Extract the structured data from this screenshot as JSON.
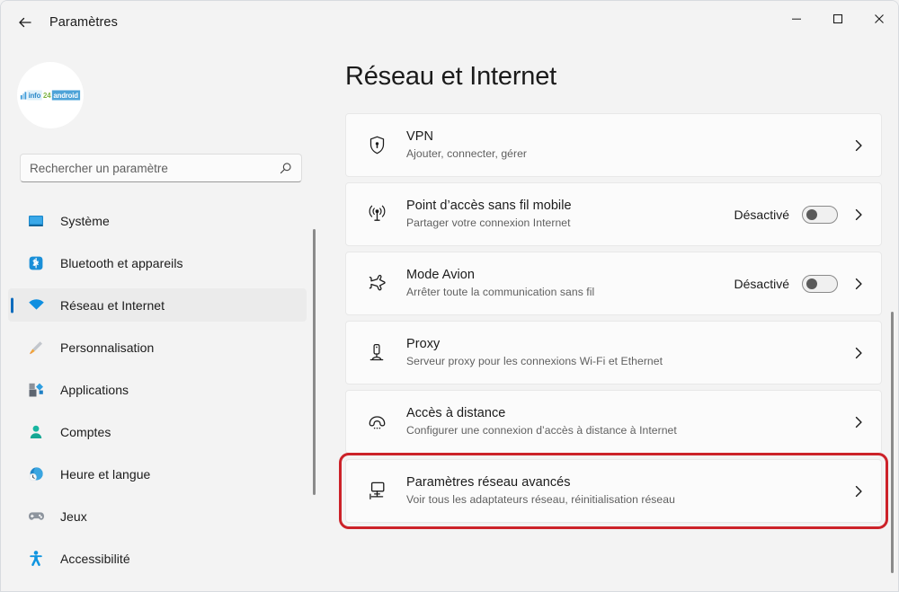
{
  "window": {
    "title": "Paramètres",
    "back_icon": "back-arrow-icon",
    "minimize_label": "—",
    "maximize_label": "□",
    "close_label": "✕"
  },
  "sidebar": {
    "avatar": {
      "logo_info": "info",
      "logo_24": "24",
      "logo_android": "android"
    },
    "search": {
      "placeholder": "Rechercher un paramètre",
      "value": "",
      "icon": "search-icon"
    },
    "items": [
      {
        "label": "Système",
        "icon": "monitor-icon",
        "selected": false
      },
      {
        "label": "Bluetooth et appareils",
        "icon": "bluetooth-icon",
        "selected": false
      },
      {
        "label": "Réseau et Internet",
        "icon": "wifi-icon",
        "selected": true
      },
      {
        "label": "Personnalisation",
        "icon": "paintbrush-icon",
        "selected": false
      },
      {
        "label": "Applications",
        "icon": "apps-icon",
        "selected": false
      },
      {
        "label": "Comptes",
        "icon": "person-icon",
        "selected": false
      },
      {
        "label": "Heure et langue",
        "icon": "clock-globe-icon",
        "selected": false
      },
      {
        "label": "Jeux",
        "icon": "gamepad-icon",
        "selected": false
      },
      {
        "label": "Accessibilité",
        "icon": "accessibility-icon",
        "selected": false
      }
    ]
  },
  "main": {
    "page_title": "Réseau et Internet",
    "cards": [
      {
        "title": "VPN",
        "subtitle": "Ajouter, connecter, gérer",
        "icon": "shield-lock-icon",
        "has_toggle": false,
        "toggle_state": "",
        "toggle_on": false,
        "highlighted": false
      },
      {
        "title": "Point d’accès sans fil mobile",
        "subtitle": "Partager votre connexion Internet",
        "icon": "hotspot-icon",
        "has_toggle": true,
        "toggle_state": "Désactivé",
        "toggle_on": false,
        "highlighted": false
      },
      {
        "title": "Mode Avion",
        "subtitle": "Arrêter toute la communication sans fil",
        "icon": "airplane-icon",
        "has_toggle": true,
        "toggle_state": "Désactivé",
        "toggle_on": false,
        "highlighted": false
      },
      {
        "title": "Proxy",
        "subtitle": "Serveur proxy pour les connexions Wi-Fi et Ethernet",
        "icon": "proxy-icon",
        "has_toggle": false,
        "toggle_state": "",
        "toggle_on": false,
        "highlighted": false
      },
      {
        "title": "Accès à distance",
        "subtitle": "Configurer une connexion d’accès à distance à Internet",
        "icon": "dialup-icon",
        "has_toggle": false,
        "toggle_state": "",
        "toggle_on": false,
        "highlighted": false
      },
      {
        "title": "Paramètres réseau avancés",
        "subtitle": "Voir tous les adaptateurs réseau, réinitialisation réseau",
        "icon": "network-adapter-icon",
        "has_toggle": false,
        "toggle_state": "",
        "toggle_on": false,
        "highlighted": true
      }
    ]
  },
  "colors": {
    "accent": "#0f6cbd",
    "highlight_border": "#cc2229",
    "window_bg": "#f3f3f3",
    "card_bg": "#fbfbfb"
  }
}
